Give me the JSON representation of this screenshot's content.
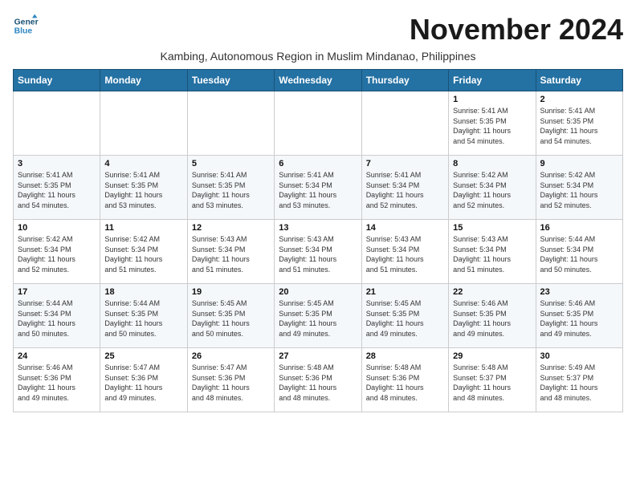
{
  "header": {
    "logo_line1": "General",
    "logo_line2": "Blue",
    "month_title": "November 2024",
    "subtitle": "Kambing, Autonomous Region in Muslim Mindanao, Philippines"
  },
  "weekdays": [
    "Sunday",
    "Monday",
    "Tuesday",
    "Wednesday",
    "Thursday",
    "Friday",
    "Saturday"
  ],
  "weeks": [
    [
      {
        "day": "",
        "info": ""
      },
      {
        "day": "",
        "info": ""
      },
      {
        "day": "",
        "info": ""
      },
      {
        "day": "",
        "info": ""
      },
      {
        "day": "",
        "info": ""
      },
      {
        "day": "1",
        "info": "Sunrise: 5:41 AM\nSunset: 5:35 PM\nDaylight: 11 hours\nand 54 minutes."
      },
      {
        "day": "2",
        "info": "Sunrise: 5:41 AM\nSunset: 5:35 PM\nDaylight: 11 hours\nand 54 minutes."
      }
    ],
    [
      {
        "day": "3",
        "info": "Sunrise: 5:41 AM\nSunset: 5:35 PM\nDaylight: 11 hours\nand 54 minutes."
      },
      {
        "day": "4",
        "info": "Sunrise: 5:41 AM\nSunset: 5:35 PM\nDaylight: 11 hours\nand 53 minutes."
      },
      {
        "day": "5",
        "info": "Sunrise: 5:41 AM\nSunset: 5:35 PM\nDaylight: 11 hours\nand 53 minutes."
      },
      {
        "day": "6",
        "info": "Sunrise: 5:41 AM\nSunset: 5:34 PM\nDaylight: 11 hours\nand 53 minutes."
      },
      {
        "day": "7",
        "info": "Sunrise: 5:41 AM\nSunset: 5:34 PM\nDaylight: 11 hours\nand 52 minutes."
      },
      {
        "day": "8",
        "info": "Sunrise: 5:42 AM\nSunset: 5:34 PM\nDaylight: 11 hours\nand 52 minutes."
      },
      {
        "day": "9",
        "info": "Sunrise: 5:42 AM\nSunset: 5:34 PM\nDaylight: 11 hours\nand 52 minutes."
      }
    ],
    [
      {
        "day": "10",
        "info": "Sunrise: 5:42 AM\nSunset: 5:34 PM\nDaylight: 11 hours\nand 52 minutes."
      },
      {
        "day": "11",
        "info": "Sunrise: 5:42 AM\nSunset: 5:34 PM\nDaylight: 11 hours\nand 51 minutes."
      },
      {
        "day": "12",
        "info": "Sunrise: 5:43 AM\nSunset: 5:34 PM\nDaylight: 11 hours\nand 51 minutes."
      },
      {
        "day": "13",
        "info": "Sunrise: 5:43 AM\nSunset: 5:34 PM\nDaylight: 11 hours\nand 51 minutes."
      },
      {
        "day": "14",
        "info": "Sunrise: 5:43 AM\nSunset: 5:34 PM\nDaylight: 11 hours\nand 51 minutes."
      },
      {
        "day": "15",
        "info": "Sunrise: 5:43 AM\nSunset: 5:34 PM\nDaylight: 11 hours\nand 51 minutes."
      },
      {
        "day": "16",
        "info": "Sunrise: 5:44 AM\nSunset: 5:34 PM\nDaylight: 11 hours\nand 50 minutes."
      }
    ],
    [
      {
        "day": "17",
        "info": "Sunrise: 5:44 AM\nSunset: 5:34 PM\nDaylight: 11 hours\nand 50 minutes."
      },
      {
        "day": "18",
        "info": "Sunrise: 5:44 AM\nSunset: 5:35 PM\nDaylight: 11 hours\nand 50 minutes."
      },
      {
        "day": "19",
        "info": "Sunrise: 5:45 AM\nSunset: 5:35 PM\nDaylight: 11 hours\nand 50 minutes."
      },
      {
        "day": "20",
        "info": "Sunrise: 5:45 AM\nSunset: 5:35 PM\nDaylight: 11 hours\nand 49 minutes."
      },
      {
        "day": "21",
        "info": "Sunrise: 5:45 AM\nSunset: 5:35 PM\nDaylight: 11 hours\nand 49 minutes."
      },
      {
        "day": "22",
        "info": "Sunrise: 5:46 AM\nSunset: 5:35 PM\nDaylight: 11 hours\nand 49 minutes."
      },
      {
        "day": "23",
        "info": "Sunrise: 5:46 AM\nSunset: 5:35 PM\nDaylight: 11 hours\nand 49 minutes."
      }
    ],
    [
      {
        "day": "24",
        "info": "Sunrise: 5:46 AM\nSunset: 5:36 PM\nDaylight: 11 hours\nand 49 minutes."
      },
      {
        "day": "25",
        "info": "Sunrise: 5:47 AM\nSunset: 5:36 PM\nDaylight: 11 hours\nand 49 minutes."
      },
      {
        "day": "26",
        "info": "Sunrise: 5:47 AM\nSunset: 5:36 PM\nDaylight: 11 hours\nand 48 minutes."
      },
      {
        "day": "27",
        "info": "Sunrise: 5:48 AM\nSunset: 5:36 PM\nDaylight: 11 hours\nand 48 minutes."
      },
      {
        "day": "28",
        "info": "Sunrise: 5:48 AM\nSunset: 5:36 PM\nDaylight: 11 hours\nand 48 minutes."
      },
      {
        "day": "29",
        "info": "Sunrise: 5:48 AM\nSunset: 5:37 PM\nDaylight: 11 hours\nand 48 minutes."
      },
      {
        "day": "30",
        "info": "Sunrise: 5:49 AM\nSunset: 5:37 PM\nDaylight: 11 hours\nand 48 minutes."
      }
    ]
  ]
}
